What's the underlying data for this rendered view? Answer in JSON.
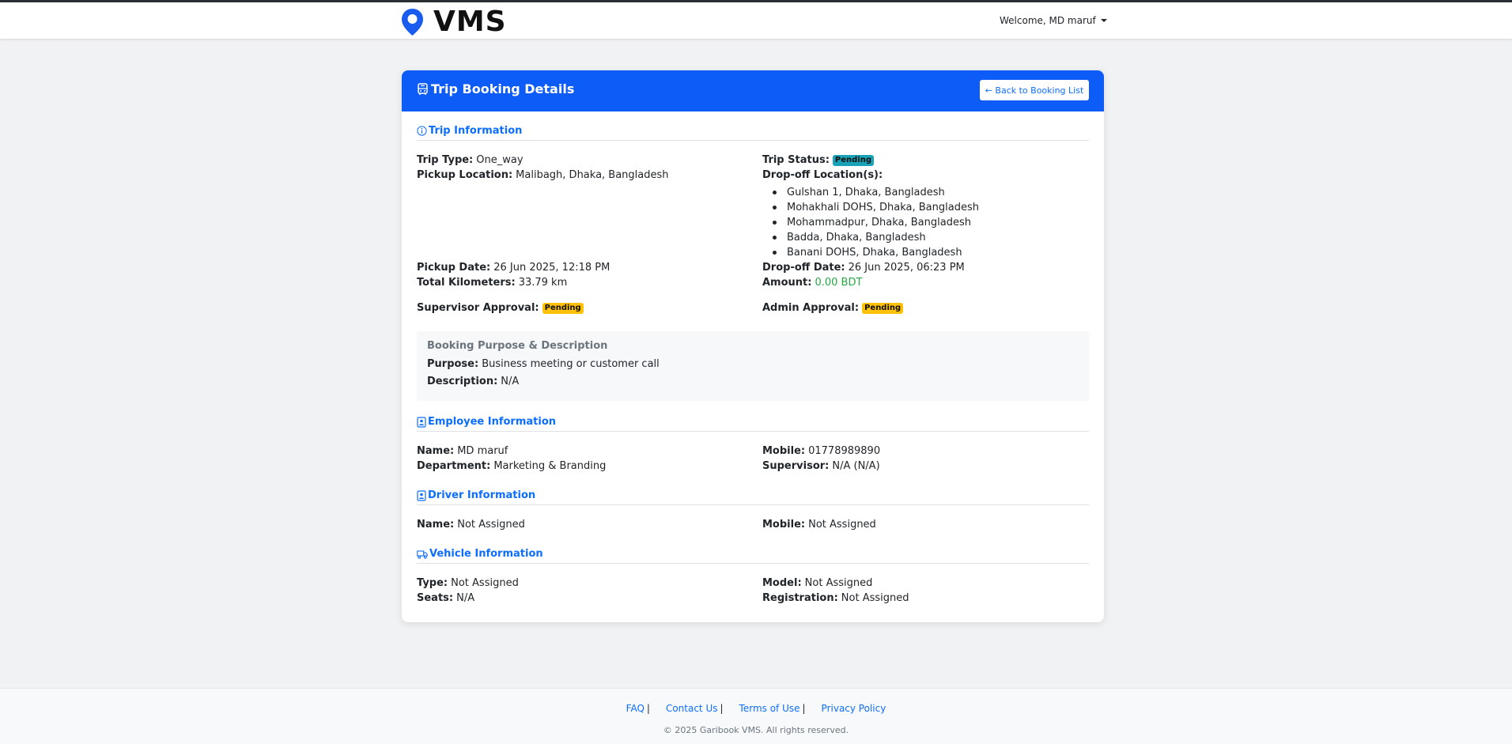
{
  "navbar": {
    "brand": "VMS",
    "welcome": "Welcome, MD maruf"
  },
  "card": {
    "title": "Trip Booking Details",
    "back_label": "← Back to Booking List"
  },
  "trip": {
    "section": "Trip Information",
    "type_label": "Trip Type:",
    "type": "One_way",
    "status_label": "Trip Status:",
    "status": "Pending",
    "pickup_label": "Pickup Location:",
    "pickup": "Malibagh, Dhaka, Bangladesh",
    "dropoff_label": "Drop-off Location(s):",
    "dropoffs": [
      "Gulshan 1, Dhaka, Bangladesh",
      "Mohakhali DOHS, Dhaka, Bangladesh",
      "Mohammadpur, Dhaka, Bangladesh",
      "Badda, Dhaka, Bangladesh",
      "Banani DOHS, Dhaka, Bangladesh"
    ],
    "pickup_date_label": "Pickup Date:",
    "pickup_date": "26 Jun 2025, 12:18 PM",
    "dropoff_date_label": "Drop-off Date:",
    "dropoff_date": "26 Jun 2025, 06:23 PM",
    "km_label": "Total Kilometers:",
    "km": "33.79 km",
    "amount_label": "Amount:",
    "amount": "0.00 BDT",
    "supervisor_label": "Supervisor Approval:",
    "supervisor": "Pending",
    "admin_label": "Admin Approval:",
    "admin": "Pending"
  },
  "purpose": {
    "title": "Booking Purpose & Description",
    "purpose_label": "Purpose:",
    "purpose": "Business meeting or customer call",
    "description_label": "Description:",
    "description": "N/A"
  },
  "employee": {
    "section": "Employee Information",
    "name_label": "Name:",
    "name": "MD maruf",
    "mobile_label": "Mobile:",
    "mobile": "01778989890",
    "department_label": "Department:",
    "department": "Marketing & Branding",
    "supervisor_label": "Supervisor:",
    "supervisor": "N/A (N/A)"
  },
  "driver": {
    "section": "Driver Information",
    "name_label": "Name:",
    "name": "Not Assigned",
    "mobile_label": "Mobile:",
    "mobile": "Not Assigned"
  },
  "vehicle": {
    "section": "Vehicle Information",
    "type_label": "Type:",
    "type": "Not Assigned",
    "model_label": "Model:",
    "model": "Not Assigned",
    "seats_label": "Seats:",
    "seats": "N/A",
    "registration_label": "Registration:",
    "registration": "Not Assigned"
  },
  "footer": {
    "links": [
      "FAQ",
      "Contact Us",
      "Terms of Use",
      "Privacy Policy"
    ],
    "separator": "|",
    "copyright": "© 2025 Garibook VMS. All rights reserved."
  },
  "colors": {
    "primary": "#0d5cf7",
    "link": "#0d6efd",
    "success": "#28a745",
    "warning": "#ffc107",
    "info": "#17a2b8"
  }
}
